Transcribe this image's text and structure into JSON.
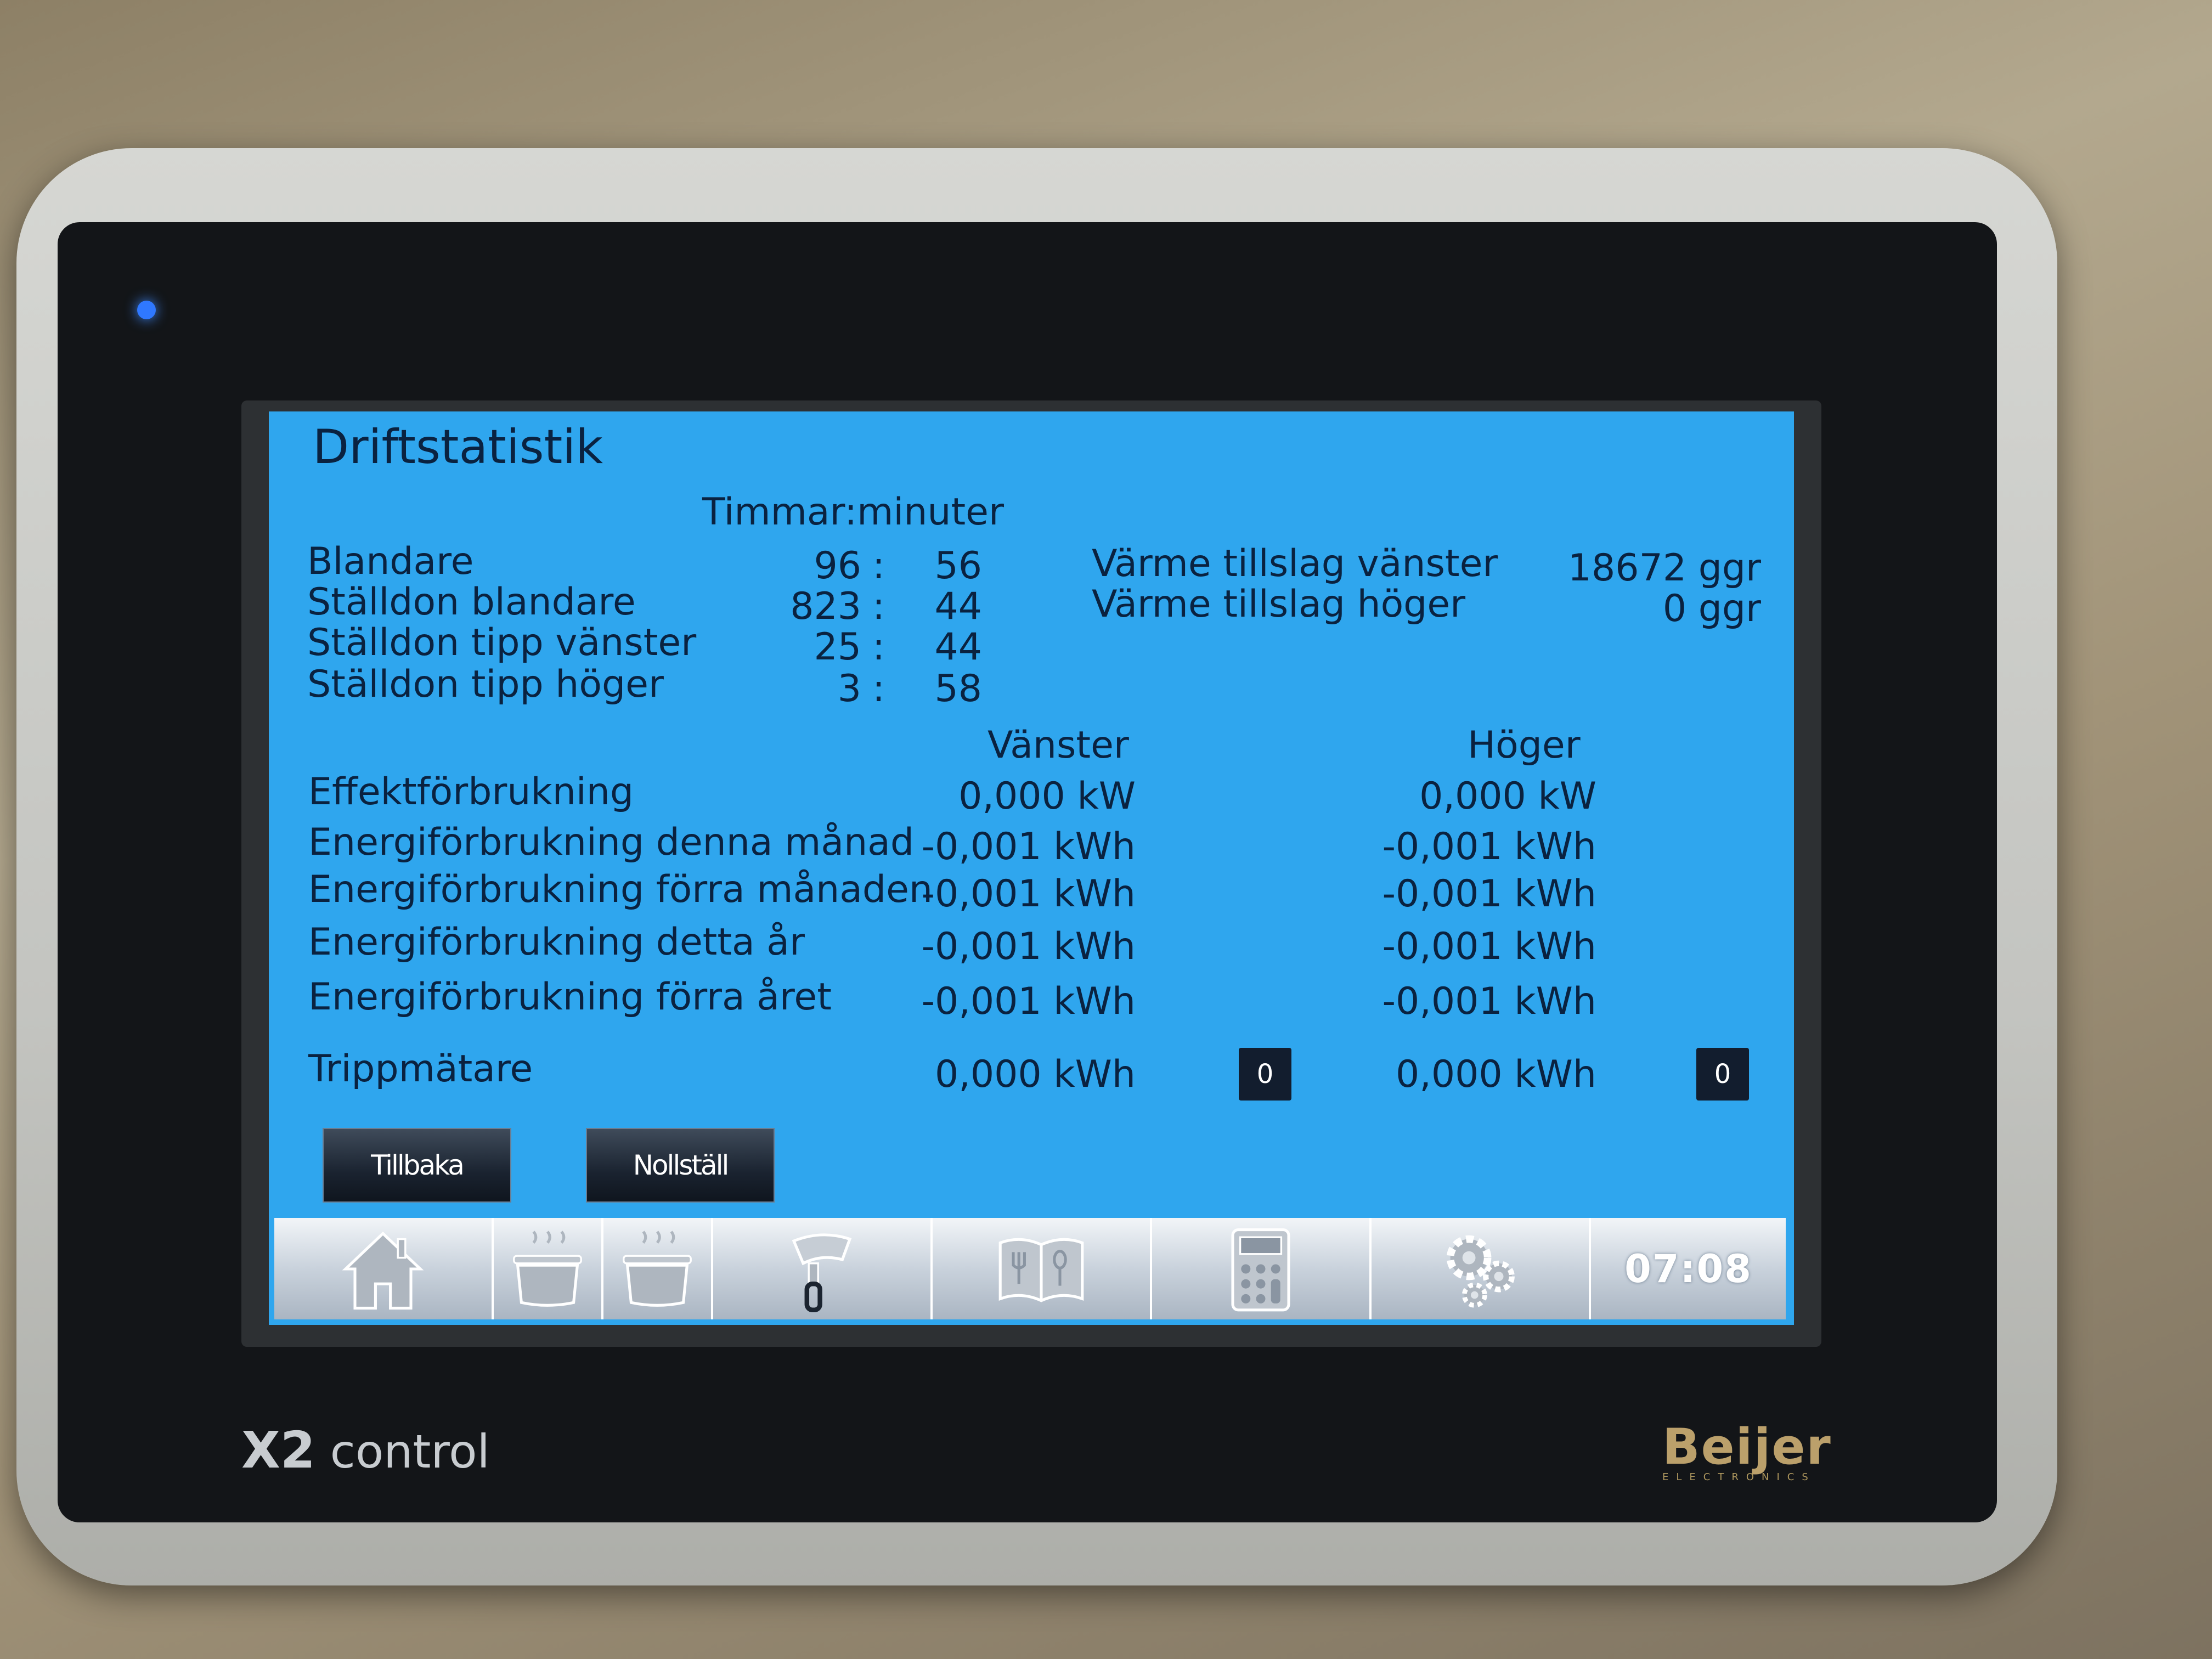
{
  "screen": {
    "title": "Driftstatistik",
    "time_header": "Timmar:minuter",
    "runtime_rows": [
      {
        "label": "Blandare",
        "hours": "96",
        "minutes": "56"
      },
      {
        "label": "Ställdon blandare",
        "hours": "823",
        "minutes": "44"
      },
      {
        "label": "Ställdon tipp vänster",
        "hours": "25",
        "minutes": "44"
      },
      {
        "label": "Ställdon tipp höger",
        "hours": "3",
        "minutes": "58"
      }
    ],
    "time_separator": ":",
    "heat_rows": [
      {
        "label": "Värme tillslag vänster",
        "value": "18672 ggr"
      },
      {
        "label": "Värme tillslag höger",
        "value": "0 ggr"
      }
    ],
    "col_left": "Vänster",
    "col_right": "Höger",
    "energy_rows": [
      {
        "label": "Effektförbrukning",
        "left": "0,000 kW",
        "right": "0,000 kW"
      },
      {
        "label": "Energiförbrukning denna månad",
        "left": "-0,001 kWh",
        "right": "-0,001 kWh"
      },
      {
        "label": "Energiförbrukning förra månaden",
        "left": "-0,001 kWh",
        "right": "-0,001 kWh"
      },
      {
        "label": "Energiförbrukning detta år",
        "left": "-0,001 kWh",
        "right": "-0,001 kWh"
      },
      {
        "label": "Energiförbrukning förra året",
        "left": "-0,001 kWh",
        "right": "-0,001 kWh"
      }
    ],
    "trip": {
      "label": "Trippmätare",
      "left": "0,000 kWh",
      "right": "0,000 kWh",
      "reset_label": "0"
    },
    "buttons": {
      "back": "Tillbaka",
      "reset": "Nollställ"
    },
    "navbar": {
      "clock": "07:08"
    }
  },
  "device": {
    "model_bold": "X2",
    "model_rest": "control",
    "brand": "Beijer",
    "brand_sub": "ELECTRONICS"
  },
  "colors": {
    "screen_bg": "#2fa6ee",
    "text": "#0a2240",
    "led": "#2f78ff"
  }
}
